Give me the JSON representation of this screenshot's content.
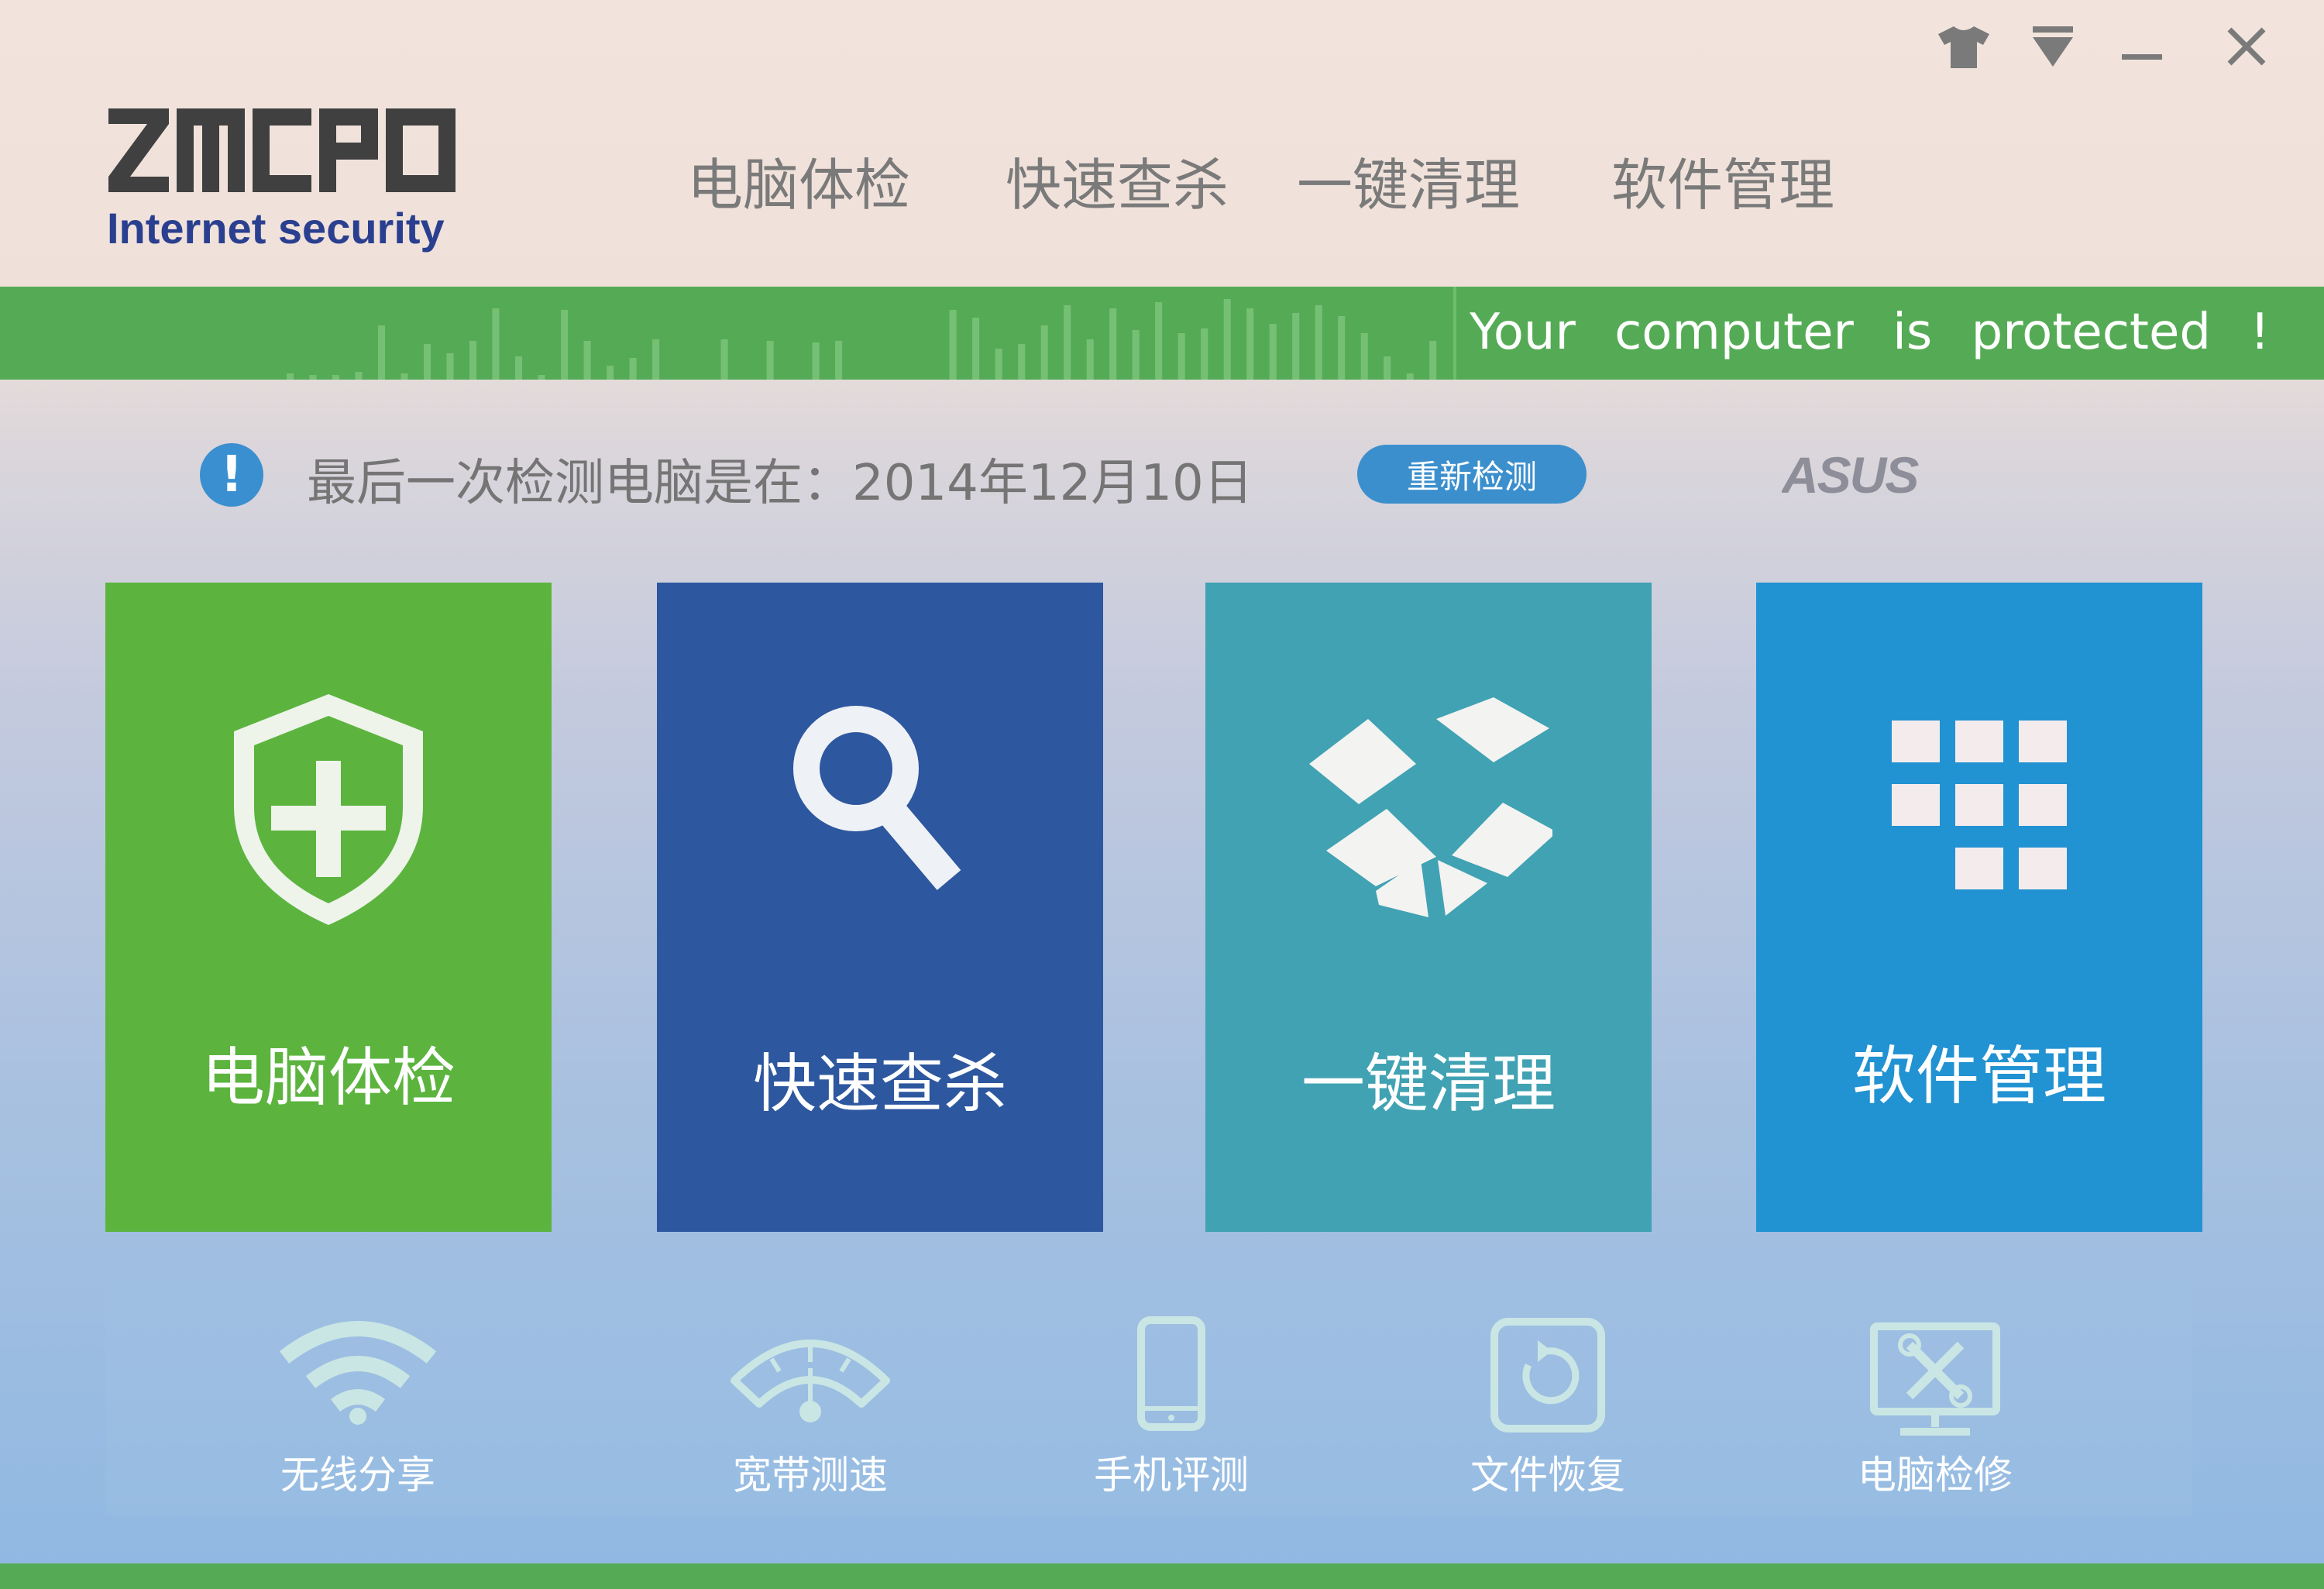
{
  "window_controls": {
    "skin_icon": "tshirt-icon",
    "menu_icon": "dropdown-menu-icon",
    "minimize_icon": "minimize-icon",
    "close_icon": "close-icon"
  },
  "brand": {
    "name": "ZMCPO",
    "subtitle": "Internet security"
  },
  "nav": {
    "items": [
      {
        "label": "电脑体检"
      },
      {
        "label": "快速查杀"
      },
      {
        "label": "一键清理"
      },
      {
        "label": "软件管理"
      }
    ]
  },
  "status": {
    "text": "Your computer is protected !"
  },
  "last_check": {
    "text": "最后一次检测电脑是在：2014年12月10日",
    "recheck_label": "重新检测",
    "partner_logo": "ASUS"
  },
  "tiles": [
    {
      "label": "电脑体检",
      "icon": "shield-plus-icon",
      "color": "#5cb43f"
    },
    {
      "label": "快速查杀",
      "icon": "magnifier-icon",
      "color": "#2d579e"
    },
    {
      "label": "一键清理",
      "icon": "open-box-icon",
      "color": "#40a2b3"
    },
    {
      "label": "软件管理",
      "icon": "app-grid-icon",
      "color": "#2192d2"
    }
  ],
  "tools": [
    {
      "label": "无线分享",
      "icon": "wifi-icon"
    },
    {
      "label": "宽带测速",
      "icon": "speedometer-icon"
    },
    {
      "label": "手机评测",
      "icon": "phone-icon"
    },
    {
      "label": "文件恢复",
      "icon": "restore-icon"
    },
    {
      "label": "电脑检修",
      "icon": "monitor-repair-icon"
    }
  ],
  "colors": {
    "accent_green": "#55ab55",
    "button_blue": "#3b8fcd",
    "brand_navy": "#2a3f8f"
  }
}
